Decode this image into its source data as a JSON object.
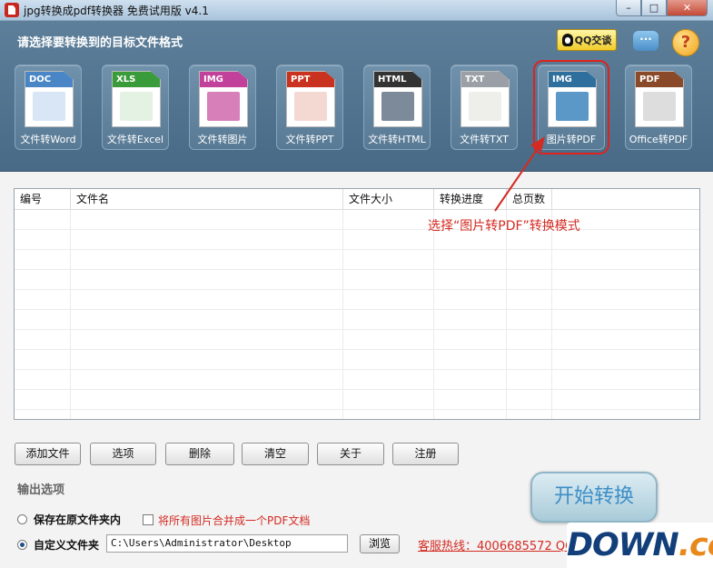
{
  "window": {
    "title": "jpg转换成pdf转换器 免费试用版 v4.1",
    "minimize": "–",
    "maximize": "□",
    "close": "✕"
  },
  "header": {
    "heading": "请选择要转换到的目标文件格式",
    "qq_label": "QQ交谈",
    "chat_glyph": "···",
    "help_glyph": "?"
  },
  "modes": [
    {
      "tag": "DOC",
      "label": "文件转Word",
      "band": "#4a86c5",
      "art": "#d9e6f5"
    },
    {
      "tag": "XLS",
      "label": "文件转Excel",
      "band": "#3a9b3a",
      "art": "#e3f2e3"
    },
    {
      "tag": "IMG",
      "label": "文件转图片",
      "band": "#c2419a",
      "art": "#d77fb9"
    },
    {
      "tag": "PPT",
      "label": "文件转PPT",
      "band": "#c8321e",
      "art": "#f4d9d3"
    },
    {
      "tag": "HTML",
      "label": "文件转HTML",
      "band": "#333333",
      "art": "#7c8a99"
    },
    {
      "tag": "TXT",
      "label": "文件转TXT",
      "band": "#9aa0a6",
      "art": "#eeeeea"
    },
    {
      "tag": "IMG",
      "label": "图片转PDF",
      "band": "#2f6f9e",
      "art": "#5c98c7"
    },
    {
      "tag": "PDF",
      "label": "Office转PDF",
      "band": "#8a4a2a",
      "art": "#dddddd"
    }
  ],
  "selected_mode": 6,
  "table": {
    "columns": [
      "编号",
      "文件名",
      "文件大小",
      "转换进度",
      "总页数",
      ""
    ],
    "row_count": 11
  },
  "annotation": "选择“图片转PDF”转换模式",
  "buttons": [
    "添加文件",
    "选项",
    "删除",
    "清空",
    "关于",
    "注册"
  ],
  "output": {
    "section_label": "输出选项",
    "keep_original_label": "保存在原文件夹内",
    "merge_label": "将所有图片合并成一个PDF文档",
    "custom_folder_label": "自定义文件夹",
    "path_value": "C:\\Users\\Administrator\\Desktop",
    "browse_label": "浏览",
    "selected": "custom"
  },
  "hotline": "客服热线：4006685572 QQ",
  "start_label": "开始转换",
  "watermark": {
    "part1": "DOWN",
    "part2": ".cc"
  }
}
